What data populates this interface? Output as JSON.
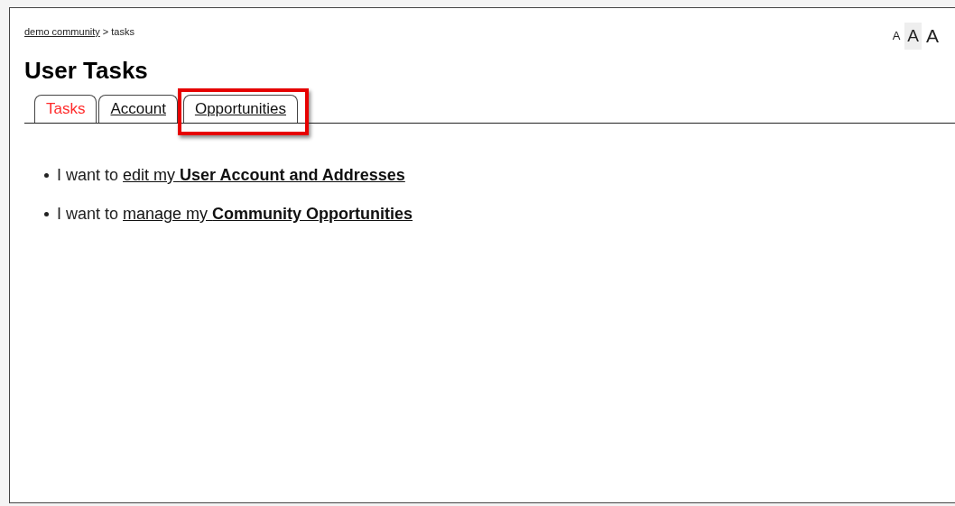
{
  "breadcrumb": {
    "link": "demo community",
    "current": "> tasks"
  },
  "font_size_buttons": [
    {
      "label": "A",
      "kind": "small",
      "selected": false
    },
    {
      "label": "A",
      "kind": "medium",
      "selected": true
    },
    {
      "label": "A",
      "kind": "large",
      "selected": false
    }
  ],
  "title": "User Tasks",
  "tabs": [
    {
      "label": "Tasks",
      "selected": true,
      "highlighted": false
    },
    {
      "label": "Account",
      "selected": false,
      "highlighted": false
    },
    {
      "label": "Opportunities",
      "selected": false,
      "highlighted": true
    }
  ],
  "tasks": [
    {
      "text": "I want to",
      "link": "edit my **User Account and Addresses**"
    },
    {
      "text": "I want to",
      "link": "manage my **Community Opportunities**"
    }
  ]
}
